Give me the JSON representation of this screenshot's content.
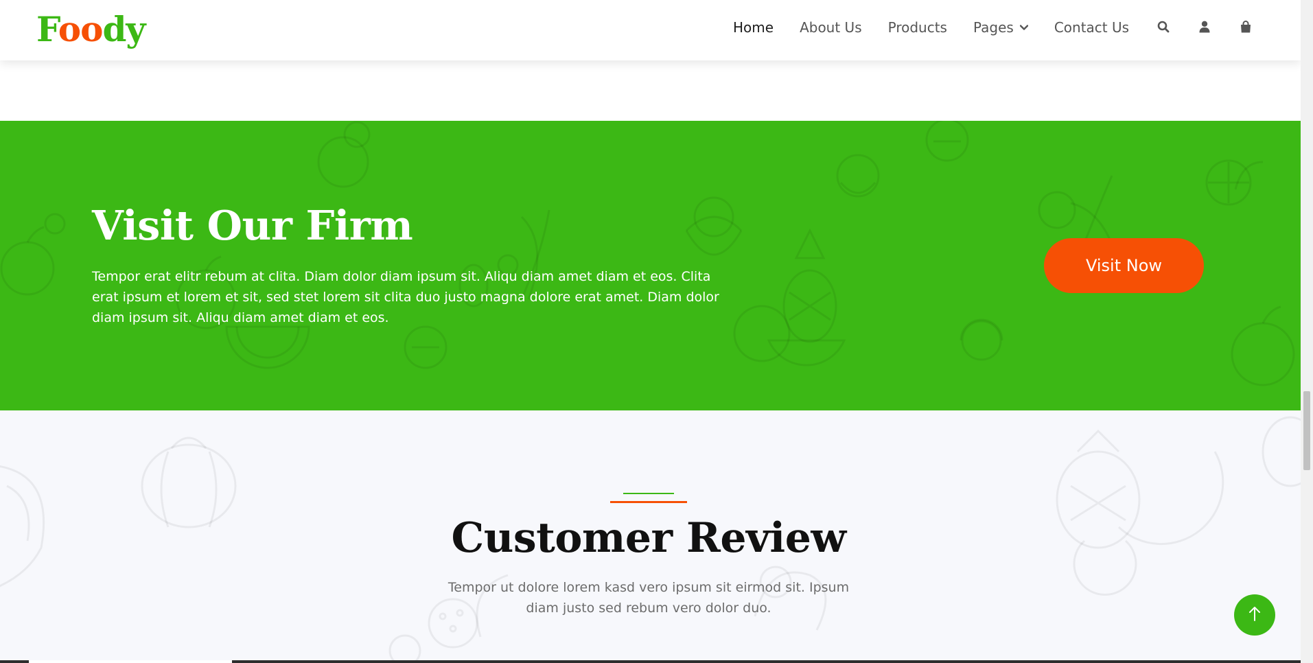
{
  "brand": {
    "part1": "F",
    "part2": "oo",
    "part3": "dy"
  },
  "nav": {
    "items": [
      {
        "label": "Home",
        "active": true
      },
      {
        "label": "About Us"
      },
      {
        "label": "Products"
      },
      {
        "label": "Pages",
        "dropdown": true
      },
      {
        "label": "Contact Us"
      }
    ],
    "icons": [
      "search-icon",
      "user-icon",
      "shopping-bag-icon"
    ]
  },
  "visit": {
    "title": "Visit Our Firm",
    "text": "Tempor erat elitr rebum at clita. Diam dolor diam ipsum sit. Aliqu diam amet diam et eos. Clita erat ipsum et lorem et sit, sed stet lorem sit clita duo justo magna dolore erat amet. Diam dolor diam ipsum sit. Aliqu diam amet diam et eos.",
    "button": "Visit Now"
  },
  "review": {
    "title": "Customer Review",
    "text": "Tempor ut dolore lorem kasd vero ipsum sit eirmod sit. Ipsum diam justo sed rebum vero dolor duo."
  },
  "colors": {
    "primary": "#3cb815",
    "secondary": "#f65005",
    "light": "#f7f8fc",
    "dark": "#111111"
  }
}
